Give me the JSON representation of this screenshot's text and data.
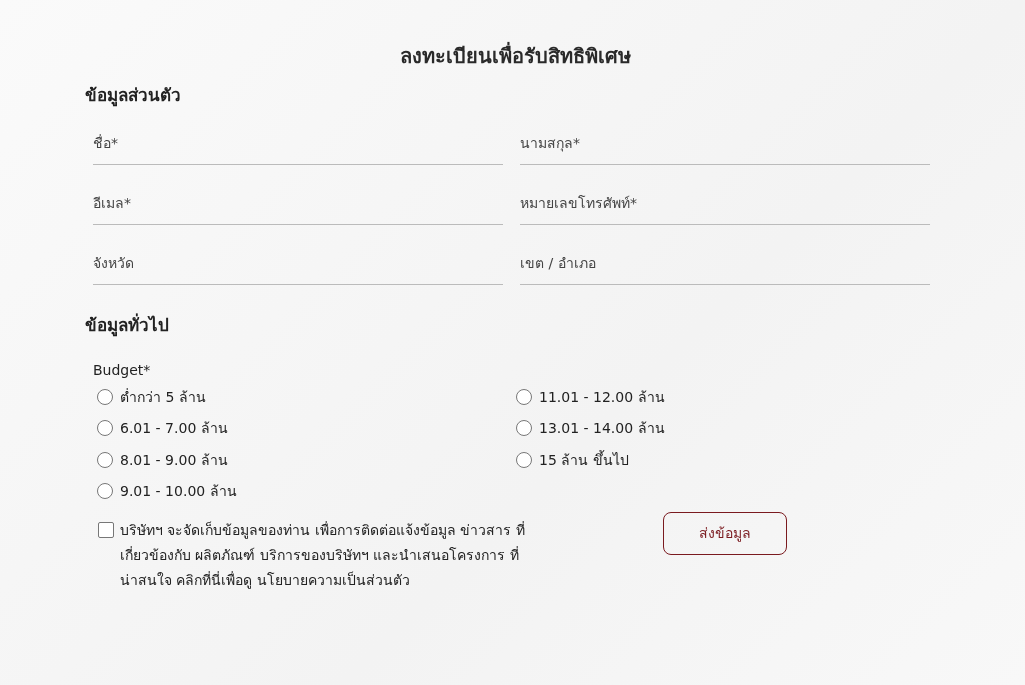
{
  "title": "ลงทะเบียนเพื่อรับสิทธิพิเศษ",
  "personal_section": {
    "heading": "ข้อมูลส่วนตัว",
    "fields": [
      {
        "placeholder": "ชื่อ*"
      },
      {
        "placeholder": "นามสกุล*"
      },
      {
        "placeholder": "อีเมล*"
      },
      {
        "placeholder": "หมายเลขโทรศัพท์*"
      },
      {
        "placeholder": "จังหวัด"
      },
      {
        "placeholder": "เขต / อำเภอ"
      }
    ]
  },
  "general_section": {
    "heading": "ข้อมูลทั่วไป",
    "budget": {
      "label": "Budget*",
      "options": [
        {
          "label": "ต่ำกว่า 5 ล้าน",
          "selected": false
        },
        {
          "label": "6.01 - 7.00 ล้าน",
          "selected": false
        },
        {
          "label": "8.01 - 9.00 ล้าน",
          "selected": false
        },
        {
          "label": "9.01 - 10.00 ล้าน",
          "selected": false
        },
        {
          "label": "11.01 - 12.00 ล้าน",
          "selected": false
        },
        {
          "label": "13.01 - 14.00 ล้าน",
          "selected": false
        },
        {
          "label": "15 ล้าน ขึ้นไป",
          "selected": false
        }
      ]
    }
  },
  "consent": {
    "text": "บริษัทฯ จะจัดเก็บข้อมูลของท่าน เพื่อการติดต่อแจ้งข้อมูล ข่าวสาร ที่เกี่ยวข้องกับ ผลิตภัณฑ์ บริการของบริษัทฯ และนำเสนอโครงการ ที่น่าสนใจ คลิกที่นี่เพื่อดู นโยบายความเป็นส่วนตัว",
    "checked": false
  },
  "submit_button": "ส่งข้อมูล"
}
